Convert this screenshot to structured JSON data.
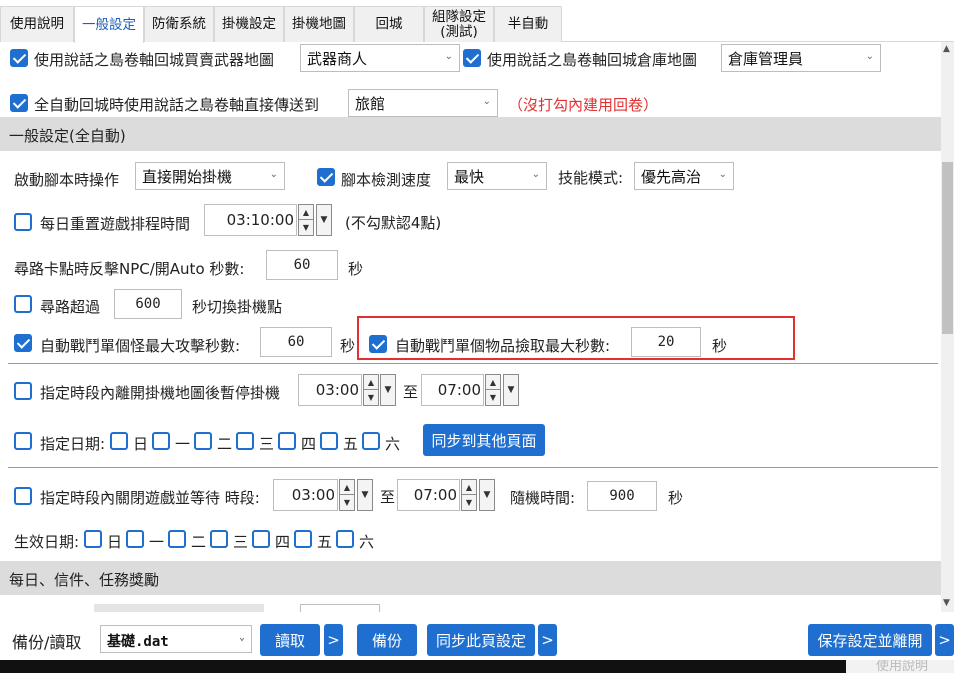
{
  "tabs": [
    {
      "label": "使用說明"
    },
    {
      "label": "一般設定"
    },
    {
      "label": "防衛系統"
    },
    {
      "label": "掛機設定"
    },
    {
      "label": "掛機地圖"
    },
    {
      "label": "回城"
    },
    {
      "label": "組隊設定\n(測試)"
    },
    {
      "label": "半自動"
    }
  ],
  "row1": {
    "label_a": "使用說話之島卷軸回城買賣武器地圖",
    "select_a": "武器商人",
    "label_b": "使用說話之島卷軸回城倉庫地圖",
    "select_b": "倉庫管理員"
  },
  "row2": {
    "label": "全自動回城時使用說話之島卷軸直接傳送到",
    "select": "旅館",
    "note": "（沒打勾內建用回卷）"
  },
  "section_auto": "一般設定(全自動)",
  "start": {
    "label": "啟動腳本時操作",
    "select": "直接開始掛機",
    "detect_label": "腳本檢測速度",
    "detect_select": "最快",
    "skill_label": "技能模式:",
    "skill_select": "優先高治"
  },
  "reset": {
    "label": "每日重置遊戲排程時間",
    "time": "03:10:00",
    "note": "(不勾默認4點)"
  },
  "stuck": {
    "label": "尋路卡點時反擊NPC/開Auto 秒數:",
    "value": "60",
    "unit": "秒"
  },
  "pathover": {
    "label": "尋路超過",
    "value": "600",
    "unit": "秒切換掛機點"
  },
  "attack": {
    "label": "自動戰鬥單個怪最大攻擊秒數:",
    "value": "60",
    "unit": "秒"
  },
  "pickup": {
    "label": "自動戰鬥單個物品撿取最大秒數:",
    "value": "20",
    "unit": "秒"
  },
  "pause": {
    "label": "指定時段內離開掛機地圖後暫停掛機",
    "from": "03:00",
    "to_label": "至",
    "to": "07:00"
  },
  "days1": {
    "label": "指定日期:",
    "days": [
      "日",
      "一",
      "二",
      "三",
      "四",
      "五",
      "六"
    ],
    "sync": "同步到其他頁面"
  },
  "close": {
    "label": "指定時段內關閉遊戲並等待 時段:",
    "from": "03:00",
    "to_label": "至",
    "to": "07:00",
    "random_label": "隨機時間:",
    "random": "900",
    "unit": "秒"
  },
  "days2": {
    "label": "生效日期:",
    "days": [
      "日",
      "一",
      "二",
      "三",
      "四",
      "五",
      "六"
    ]
  },
  "section_daily": "每日、信件、任務獎勵",
  "footer": {
    "backup_label": "備份/讀取",
    "file": "基礎.dat",
    "read": "讀取",
    "more": ">",
    "backup": "備份",
    "sync": "同步此頁設定",
    "save": "保存設定並離開"
  },
  "ghost": "使用說明",
  "colors": {
    "accent": "#1e6fd0",
    "highlight": "#e03030",
    "note": "#e03030"
  }
}
